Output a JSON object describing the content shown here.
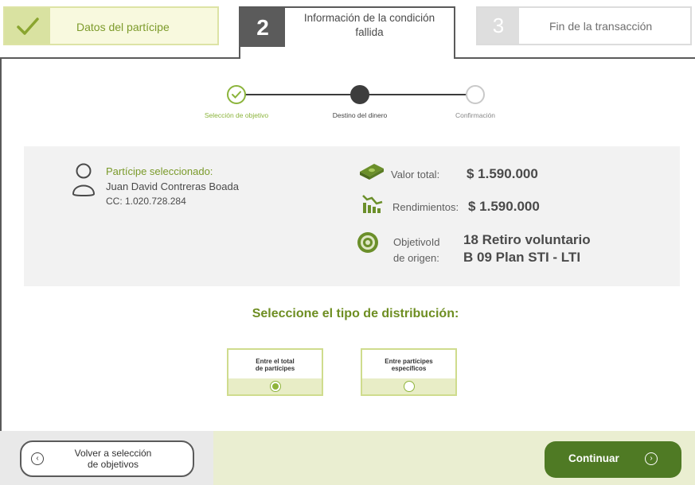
{
  "tabs": [
    {
      "number": "",
      "label": "Datos del partícipe",
      "state": "done"
    },
    {
      "number": "2",
      "label": "Información de la condición fallida",
      "state": "active"
    },
    {
      "number": "3",
      "label": "Fin de la transacción",
      "state": "pending"
    }
  ],
  "stepper": {
    "steps": [
      {
        "label": "Selección de objetivo",
        "state": "done"
      },
      {
        "label": "Destino del dinero",
        "state": "current"
      },
      {
        "label": "Confirmación",
        "state": "pending"
      }
    ]
  },
  "participant": {
    "title": "Partícipe seleccionado:",
    "name": "Juan David Contreras Boada",
    "cc": "CC: 1.020.728.284"
  },
  "summary": {
    "total_label": "Valor total:",
    "total_value": "$ 1.590.000",
    "returns_label": "Rendimientos:",
    "returns_value": "$ 1.590.000",
    "origin_label_1": "ObjetivoId",
    "origin_label_2": "de origen:",
    "origin_value_1": "18 Retiro voluntario",
    "origin_value_2": "B 09 Plan STI - LTI"
  },
  "distribution": {
    "title": "Seleccione el tipo de distribución:",
    "options": [
      {
        "line1": "Entre el total",
        "line2": "de partícipes",
        "selected": true
      },
      {
        "line1": "Entre partícipes",
        "line2": "específicos",
        "selected": false
      }
    ]
  },
  "footer": {
    "back_line1": "Volver a selección",
    "back_line2": "de objetivos",
    "continue_label": "Continuar"
  },
  "colors": {
    "accent_green": "#8fb43c",
    "dark_green": "#4f7a24",
    "title_green": "#6e8e22"
  }
}
